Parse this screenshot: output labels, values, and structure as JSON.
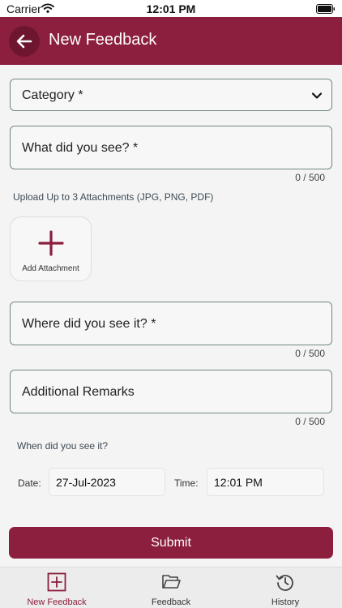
{
  "status_bar": {
    "carrier": "Carrier",
    "time": "12:01 PM"
  },
  "header": {
    "title": "New Feedback"
  },
  "form": {
    "category": {
      "placeholder": "Category *"
    },
    "what_did_you_see": {
      "placeholder": "What did you see? *",
      "counter": "0 / 500"
    },
    "upload_hint": "Upload Up to 3 Attachments (JPG, PNG, PDF)",
    "add_attachment_label": "Add Attachment",
    "where_did_you_see": {
      "placeholder": "Where did you see it? *",
      "counter": "0 / 500"
    },
    "additional_remarks": {
      "placeholder": "Additional Remarks",
      "counter": "0 / 500"
    },
    "when_label": "When did you see it?",
    "date": {
      "label": "Date:",
      "value": "27-Jul-2023"
    },
    "time": {
      "label": "Time:",
      "value": "12:01 PM"
    },
    "submit_label": "Submit"
  },
  "tabs": [
    {
      "label": "New Feedback",
      "icon": "plus-square-icon",
      "active": true
    },
    {
      "label": "Feedback",
      "icon": "folder-icon",
      "active": false
    },
    {
      "label": "History",
      "icon": "history-icon",
      "active": false
    }
  ],
  "colors": {
    "brand": "#8c1f3d",
    "field_border": "#6f8a7a"
  }
}
